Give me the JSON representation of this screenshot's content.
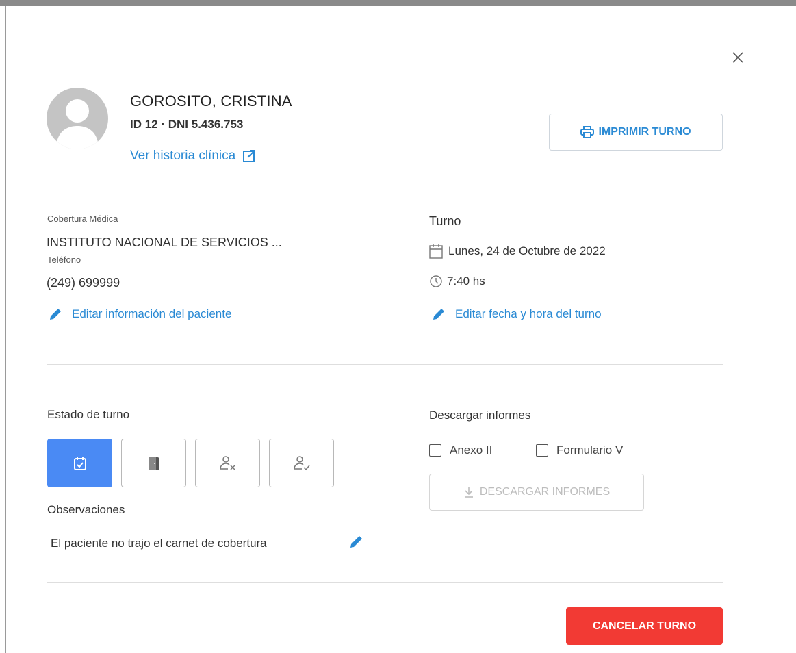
{
  "patient": {
    "name": "GOROSITO, CRISTINA",
    "ids": "ID 12 · DNI 5.436.753",
    "history_link": "Ver historia clínica"
  },
  "actions": {
    "print_label": "IMPRIMIR TURNO",
    "cancel_label": "CANCELAR TURNO"
  },
  "patient_info": {
    "coverage_label": "Cobertura Médica",
    "coverage_value": "INSTITUTO NACIONAL DE SERVICIOS ...",
    "phone_label": "Teléfono",
    "phone_value": "(249) 699999",
    "edit_link": "Editar información del paciente"
  },
  "appointment": {
    "title": "Turno",
    "date": "Lunes, 24 de Octubre de 2022",
    "time": "7:40 hs",
    "edit_link": "Editar fecha y hora del turno"
  },
  "status": {
    "title": "Estado de turno",
    "buttons": [
      {
        "icon": "calendar-check-icon",
        "active": true
      },
      {
        "icon": "door-icon",
        "active": false
      },
      {
        "icon": "user-x-icon",
        "active": false
      },
      {
        "icon": "user-check-icon",
        "active": false
      }
    ],
    "active_color": "#4a8af4"
  },
  "observations": {
    "title": "Observaciones",
    "text": "El paciente no trajo el carnet de cobertura"
  },
  "reports": {
    "title": "Descargar informes",
    "options": [
      "Anexo II",
      "Formulario V"
    ],
    "download_label": "DESCARGAR INFORMES"
  },
  "colors": {
    "link": "#2a8ad4",
    "danger": "#f23a34"
  }
}
